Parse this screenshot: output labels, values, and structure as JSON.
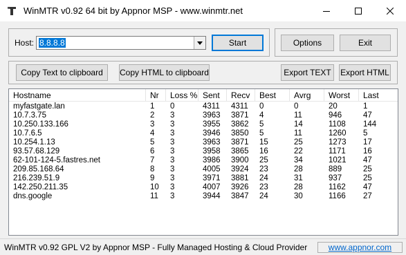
{
  "window": {
    "title": "WinMTR v0.92 64 bit by Appnor MSP - www.winmtr.net",
    "controls": {
      "minimize": "─",
      "maximize": "☐",
      "close": "✕"
    }
  },
  "host": {
    "label": "Host:",
    "value": "8.8.8.8",
    "start_label": "Start"
  },
  "toolbar": {
    "options_label": "Options",
    "exit_label": "Exit",
    "copy_text_label": "Copy Text to clipboard",
    "copy_html_label": "Copy HTML to clipboard",
    "export_text_label": "Export TEXT",
    "export_html_label": "Export HTML"
  },
  "table": {
    "columns": [
      "Hostname",
      "Nr",
      "Loss %",
      "Sent",
      "Recv",
      "Best",
      "Avrg",
      "Worst",
      "Last"
    ],
    "rows": [
      [
        "myfastgate.lan",
        "1",
        "0",
        "4311",
        "4311",
        "0",
        "0",
        "20",
        "1"
      ],
      [
        "10.7.3.75",
        "2",
        "3",
        "3963",
        "3871",
        "4",
        "11",
        "946",
        "47"
      ],
      [
        "10.250.133.166",
        "3",
        "3",
        "3955",
        "3862",
        "5",
        "14",
        "1108",
        "144"
      ],
      [
        "10.7.6.5",
        "4",
        "3",
        "3946",
        "3850",
        "5",
        "11",
        "1260",
        "5"
      ],
      [
        "10.254.1.13",
        "5",
        "3",
        "3963",
        "3871",
        "15",
        "25",
        "1273",
        "17"
      ],
      [
        "93.57.68.129",
        "6",
        "3",
        "3958",
        "3865",
        "16",
        "22",
        "1171",
        "16"
      ],
      [
        "62-101-124-5.fastres.net",
        "7",
        "3",
        "3986",
        "3900",
        "25",
        "34",
        "1021",
        "47"
      ],
      [
        "209.85.168.64",
        "8",
        "3",
        "4005",
        "3924",
        "23",
        "28",
        "889",
        "25"
      ],
      [
        "216.239.51.9",
        "9",
        "3",
        "3971",
        "3881",
        "24",
        "31",
        "937",
        "25"
      ],
      [
        "142.250.211.35",
        "10",
        "3",
        "4007",
        "3926",
        "23",
        "28",
        "1162",
        "47"
      ],
      [
        "dns.google",
        "11",
        "3",
        "3944",
        "3847",
        "24",
        "30",
        "1166",
        "27"
      ]
    ]
  },
  "statusbar": {
    "text": "WinMTR v0.92 GPL V2 by Appnor MSP - Fully Managed Hosting & Cloud Provider",
    "link": "www.appnor.com"
  },
  "colors": {
    "selection": "#0078d7",
    "default_button_border": "#0078d7",
    "link": "#0066cc"
  }
}
